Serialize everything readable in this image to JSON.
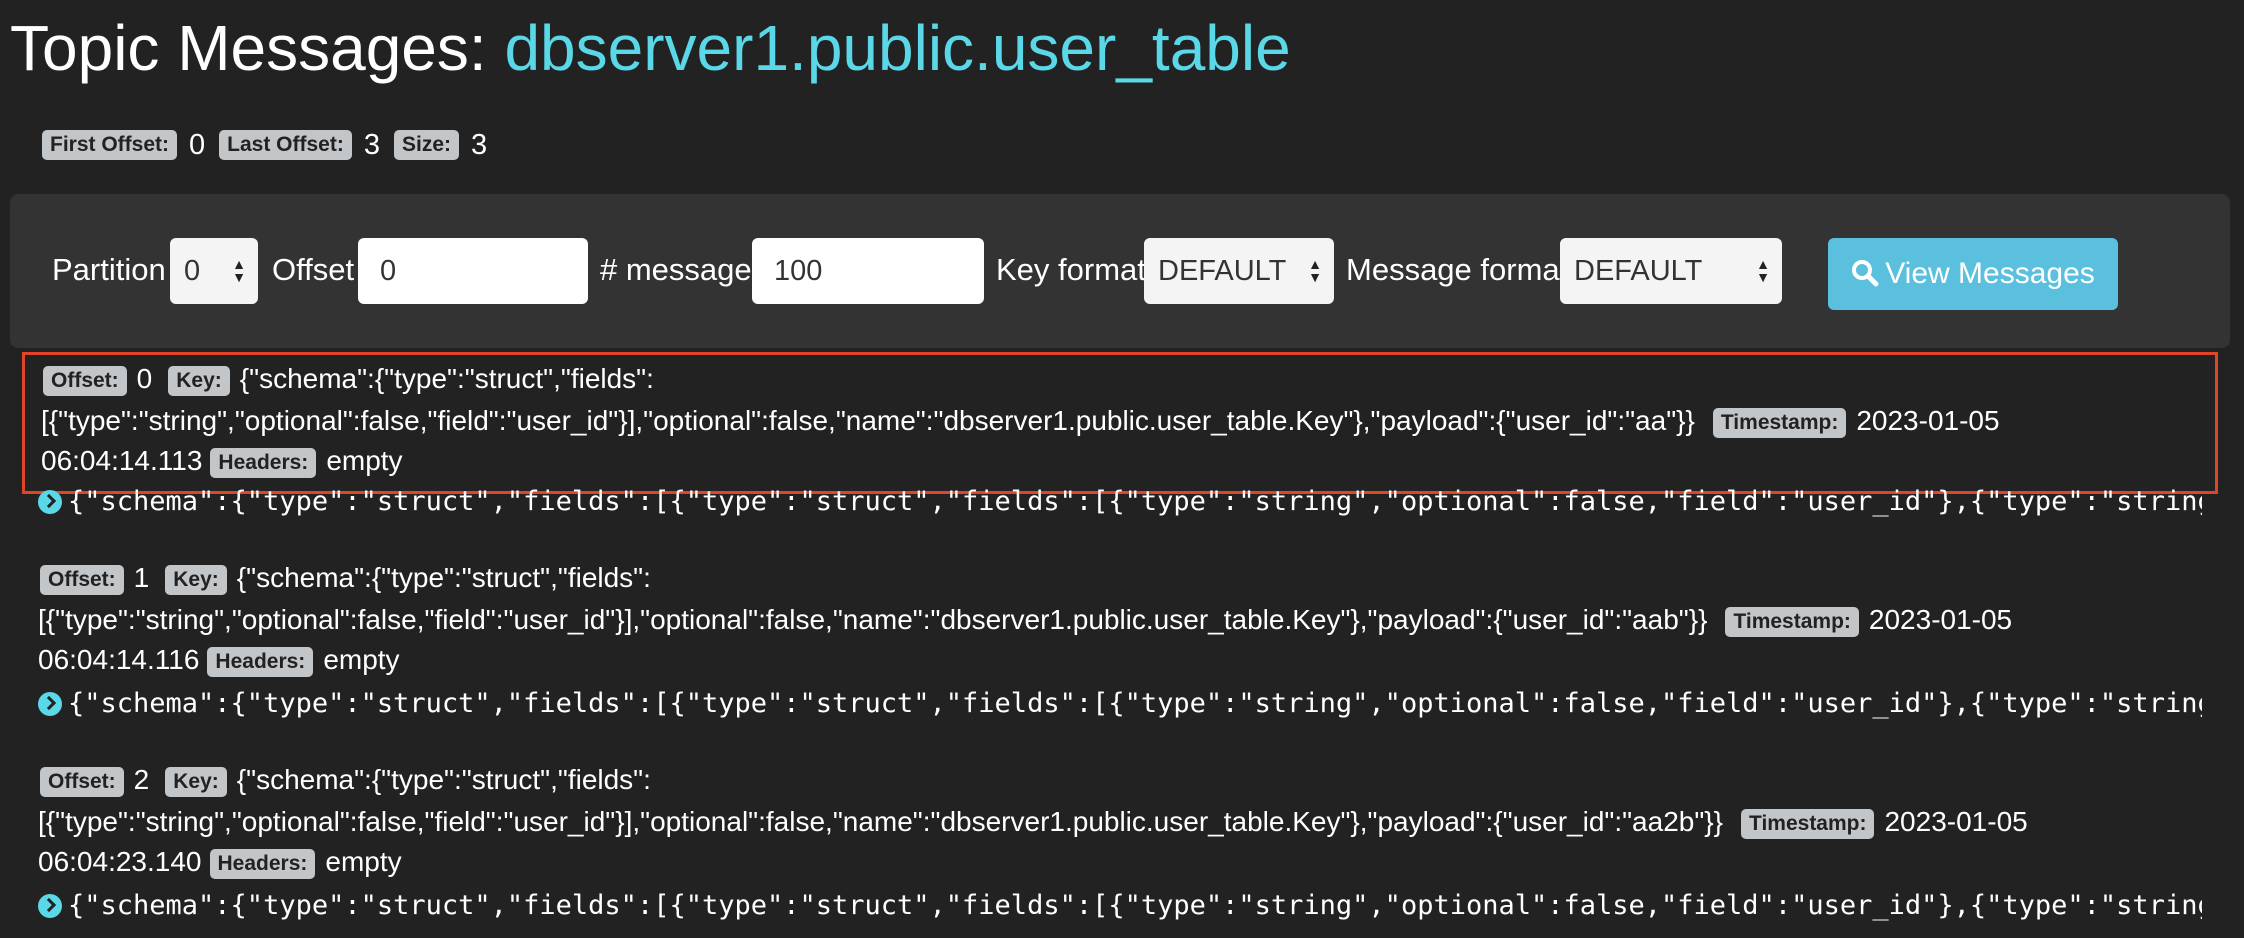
{
  "header": {
    "title_prefix": "Topic Messages: ",
    "topic_name": "dbserver1.public.user_table"
  },
  "summary": {
    "first_offset_label": "First Offset:",
    "first_offset": "0",
    "last_offset_label": "Last Offset:",
    "last_offset": "3",
    "size_label": "Size:",
    "size": "3"
  },
  "controls": {
    "partition_label": "Partition",
    "partition_value": "0",
    "offset_label": "Offset",
    "offset_value": "0",
    "messages_label": "# messages",
    "messages_value": "100",
    "key_format_label": "Key format",
    "key_format_value": "DEFAULT",
    "message_format_label": "Message format",
    "message_format_value": "DEFAULT",
    "view_button_label": "View Messages"
  },
  "labels": {
    "offset": "Offset:",
    "key": "Key:",
    "timestamp": "Timestamp:",
    "headers": "Headers:"
  },
  "messages": [
    {
      "offset": "0",
      "key_line1": "{\"schema\":{\"type\":\"struct\",\"fields\":",
      "key_line2": "[{\"type\":\"string\",\"optional\":false,\"field\":\"user_id\"}],\"optional\":false,\"name\":\"dbserver1.public.user_table.Key\"},\"payload\":{\"user_id\":\"aa\"}}",
      "timestamp_date": "2023-01-05",
      "timestamp_time": "06:04:14.113",
      "headers": "empty",
      "value": "{\"schema\":{\"type\":\"struct\",\"fields\":[{\"type\":\"struct\",\"fields\":[{\"type\":\"string\",\"optional\":false,\"field\":\"user_id\"},{\"type\":\"string\",\"o"
    },
    {
      "offset": "1",
      "key_line1": "{\"schema\":{\"type\":\"struct\",\"fields\":",
      "key_line2": "[{\"type\":\"string\",\"optional\":false,\"field\":\"user_id\"}],\"optional\":false,\"name\":\"dbserver1.public.user_table.Key\"},\"payload\":{\"user_id\":\"aab\"}}",
      "timestamp_date": "2023-01-05",
      "timestamp_time": "06:04:14.116",
      "headers": "empty",
      "value": "{\"schema\":{\"type\":\"struct\",\"fields\":[{\"type\":\"struct\",\"fields\":[{\"type\":\"string\",\"optional\":false,\"field\":\"user_id\"},{\"type\":\"string\",\"o"
    },
    {
      "offset": "2",
      "key_line1": "{\"schema\":{\"type\":\"struct\",\"fields\":",
      "key_line2": "[{\"type\":\"string\",\"optional\":false,\"field\":\"user_id\"}],\"optional\":false,\"name\":\"dbserver1.public.user_table.Key\"},\"payload\":{\"user_id\":\"aa2b\"}}",
      "timestamp_date": "2023-01-05",
      "timestamp_time": "06:04:23.140",
      "headers": "empty",
      "value": "{\"schema\":{\"type\":\"struct\",\"fields\":[{\"type\":\"struct\",\"fields\":[{\"type\":\"string\",\"optional\":false,\"field\":\"user_id\"},{\"type\":\"string\",\"o"
    }
  ],
  "colors": {
    "background": "#222222",
    "panel": "#333333",
    "accent": "#5bd8e8",
    "button": "#5bc0de",
    "badge": "#c3c6c9",
    "selection_border": "#e0452a"
  },
  "icons": {
    "search": "search-icon",
    "expand": "expand-icon",
    "select_arrows": "select-arrows-icon"
  }
}
